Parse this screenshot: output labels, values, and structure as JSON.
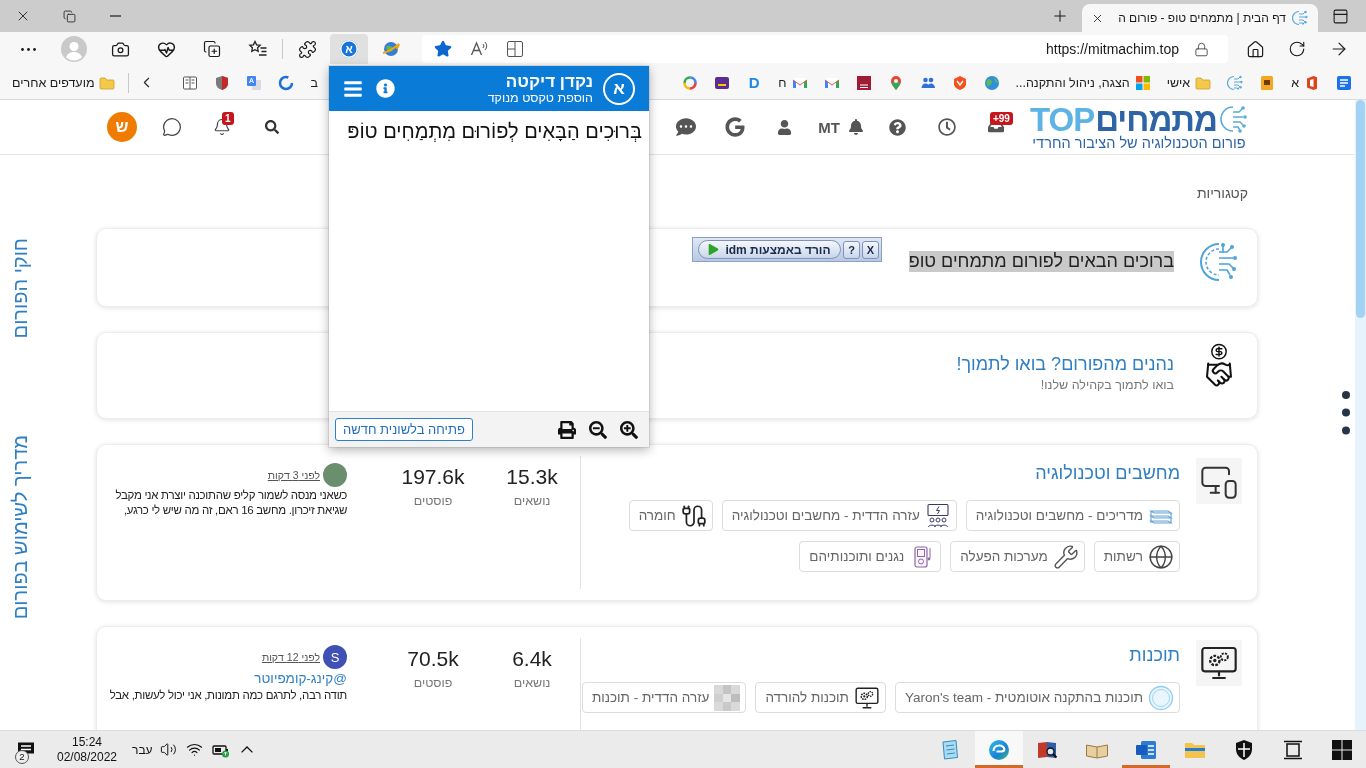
{
  "window": {
    "tabs": [
      {
        "title": "דף הבית | מתמחים טופ - פורום ה",
        "selected": true
      }
    ]
  },
  "toolbar": {
    "extensions": [
      {
        "kind": "puzzle",
        "selected": false
      },
      {
        "kind": "nakdan",
        "glyph": "א",
        "selected": true
      },
      {
        "kind": "idm",
        "selected": false
      }
    ],
    "url": "https://mitmachim.top"
  },
  "bookmarks_bar": {
    "other_favorites": "מועדפים אחרים",
    "more_items": [
      {
        "label": "ב"
      },
      {
        "kind": "ring"
      },
      {
        "kind": "translate"
      },
      {
        "kind": "shield"
      },
      {
        "kind": "reader"
      }
    ],
    "items": [
      {
        "kind": "note"
      },
      {
        "kind": "office",
        "label": "א"
      },
      {
        "kind": "sticky"
      },
      {
        "kind": "brain"
      },
      {
        "kind": "folder",
        "label": "אישי"
      },
      {
        "kind": "windows",
        "label": "הצגה, ניהול והתקנה..."
      },
      {
        "kind": "earth"
      },
      {
        "kind": "orangebook"
      },
      {
        "kind": "people"
      },
      {
        "kind": "pin"
      },
      {
        "kind": "tips"
      },
      {
        "kind": "gmail"
      },
      {
        "kind": "gmail",
        "label": "ח"
      },
      {
        "kind": "letter",
        "glyph": "D"
      },
      {
        "kind": "purple"
      },
      {
        "kind": "google"
      }
    ]
  },
  "forum_header": {
    "logo": {
      "name": "מתמחים",
      "name_latin": "TOP",
      "tagline": "פורום הטכנולוגיה של הציבור החרדי"
    },
    "nav": [
      {
        "kind": "inbox",
        "badge": "+99"
      },
      {
        "kind": "clock"
      },
      {
        "kind": "help"
      },
      {
        "kind": "bell",
        "label": "MT"
      },
      {
        "kind": "user"
      },
      {
        "kind": "google"
      },
      {
        "kind": "chat"
      }
    ],
    "user_menu": [
      {
        "kind": "search"
      },
      {
        "kind": "bell",
        "badge": "1"
      },
      {
        "kind": "chat"
      },
      {
        "kind": "avatar",
        "letter": "ש"
      }
    ]
  },
  "side_links": [
    "חוקי הפורום",
    "מדריך לשימוש בפורום"
  ],
  "categories_title": "קטגוריות",
  "categories": [
    {
      "kind": "notice",
      "title": "ברוכים הבאים לפורום מתמחים טופ",
      "highlighted": true
    },
    {
      "kind": "notice",
      "title": "נהנים מהפורום? בואו לתמוך!",
      "subtitle": "בואו לתמוך בקהילה שלנו!",
      "highlighted": false
    },
    {
      "kind": "forum",
      "title": "מחשבים וטכנולוגיה",
      "stats": [
        {
          "value": "15.3k",
          "label": "נושאים"
        },
        {
          "value": "197.6k",
          "label": "פוסטים"
        }
      ],
      "last_post": {
        "avatar": {
          "kind": "photo"
        },
        "time": "לפני 3 דקות",
        "text": "כשאני מנסה לשמור קליפ שהתוכנה יוצרת אני מקבל שגיאת זיכרון. מחשב 16 ראם, זה מה שיש לי כרגע,"
      },
      "subcategory_rows": [
        [
          {
            "kind": "books",
            "label": "מדריכים - מחשבים וטכנולוגיה"
          },
          {
            "kind": "helpdesk",
            "label": "עזרה הדדית - מחשבים וטכנולוגיה"
          },
          {
            "kind": "cables",
            "label": "חומרה"
          }
        ],
        [
          {
            "kind": "globe",
            "label": "רשתות"
          },
          {
            "kind": "tools",
            "label": "מערכות הפעלה"
          },
          {
            "kind": "player",
            "label": "נגנים ותוכנותיהם"
          }
        ]
      ]
    },
    {
      "kind": "forum",
      "title": "תוכנות",
      "stats": [
        {
          "value": "6.4k",
          "label": "נושאים"
        },
        {
          "value": "70.5k",
          "label": "פוסטים"
        }
      ],
      "last_post": {
        "avatar": {
          "kind": "letter",
          "letter": "S"
        },
        "time": "לפני 12 דקות",
        "mention": "@קינג-קומפיוטר",
        "text": "תודה רבה, לתרגם כמה תמונות, אני יכול לעשות, אבל"
      },
      "subcategory_rows": [
        [
          {
            "kind": "badge",
            "label": "תוכנות בהתקנה אוטומטית - Yaron's team"
          },
          {
            "kind": "gears",
            "label": "תוכנות להורדה"
          },
          {
            "kind": "blurred",
            "label": "עזרה הדדית - תוכנות"
          }
        ]
      ]
    }
  ],
  "idm_bar": {
    "label": "הורד באמצעות idm",
    "help": "?",
    "close": "X"
  },
  "popup": {
    "title": "נקדן דיקטה",
    "subtitle": "הוספת טקסט מנוקד",
    "logo_glyph": "א",
    "text": "בְּרוּכִים הַבָּאִים לְפוֹרוּם מִתְמַחִים טוֹפּ",
    "open_button": "פתיחה בלשונית חדשה"
  },
  "taskbar": {
    "notifications": "2",
    "time": "15:24",
    "date": "02/08/2022",
    "language": "עבר",
    "apps": [
      {
        "kind": "notepad",
        "running": false,
        "selected": false
      },
      {
        "kind": "edge",
        "running": true,
        "selected": true
      },
      {
        "kind": "dictionary",
        "running": false,
        "selected": false
      },
      {
        "kind": "book",
        "running": false,
        "selected": false
      },
      {
        "kind": "word",
        "running": true,
        "selected": false
      },
      {
        "kind": "explorer",
        "running": false,
        "selected": false
      },
      {
        "kind": "security",
        "running": false,
        "selected": false
      },
      {
        "kind": "taskview",
        "running": false,
        "selected": false
      },
      {
        "kind": "start",
        "running": false,
        "selected": false
      }
    ]
  }
}
